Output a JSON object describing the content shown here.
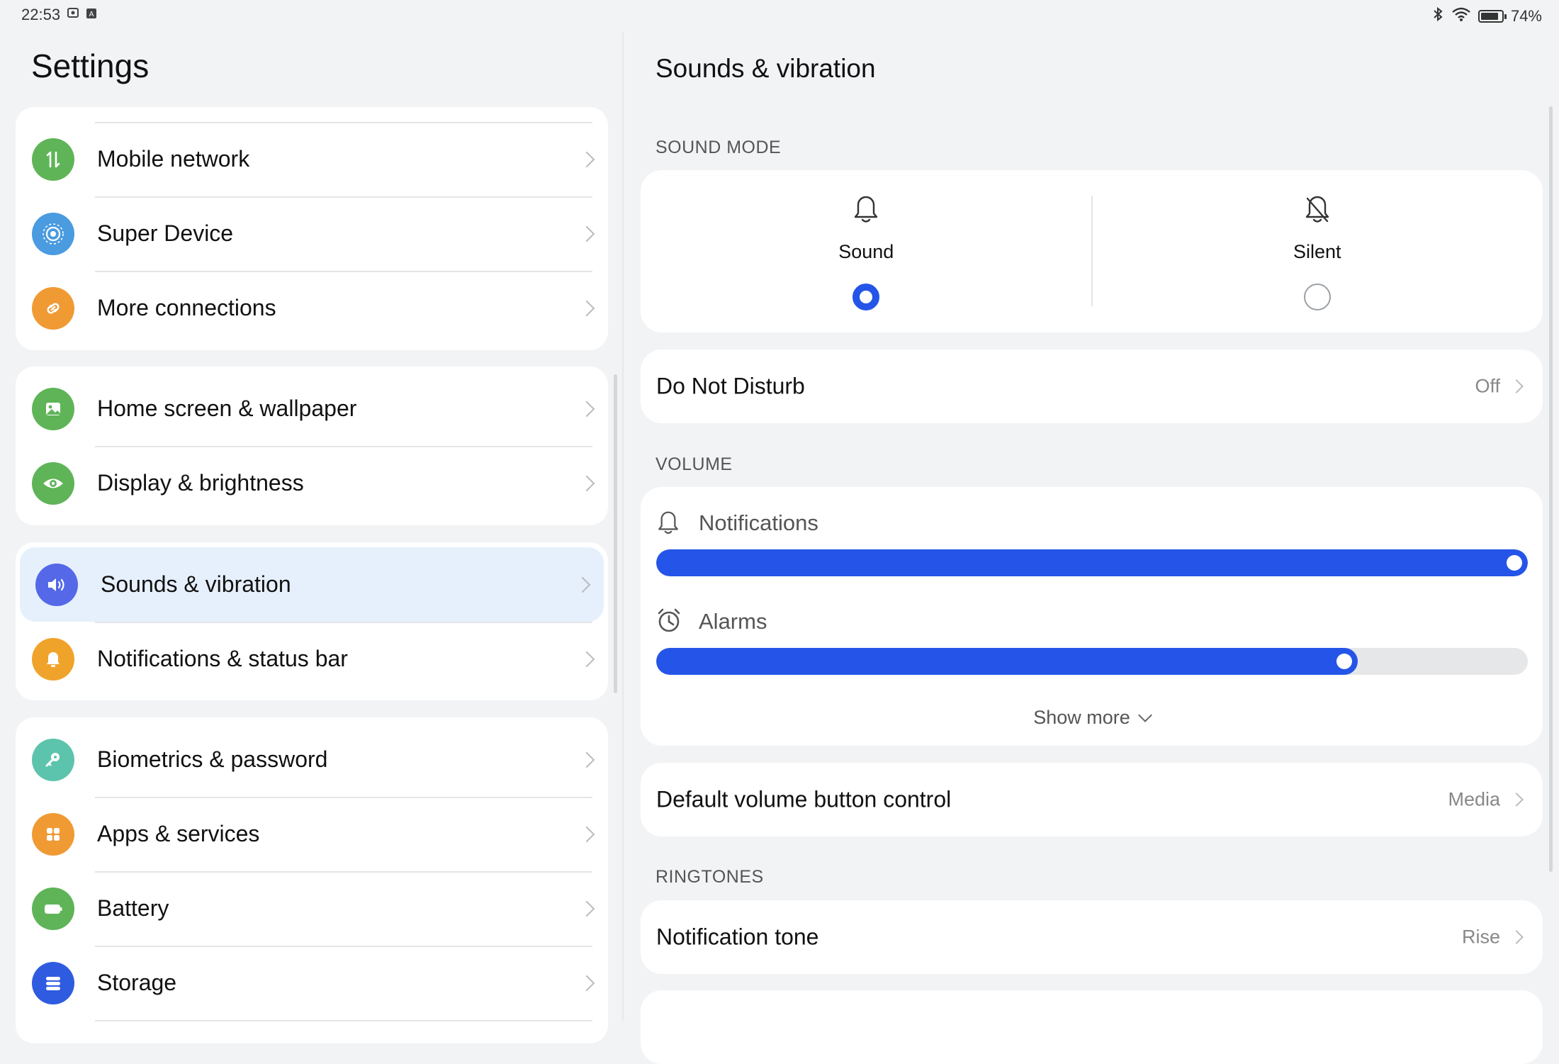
{
  "status_bar": {
    "time": "22:53",
    "battery_percent": "74%",
    "battery_level": 0.74
  },
  "left": {
    "title": "Settings",
    "groups": [
      {
        "items": [
          {
            "label": "Mobile network",
            "icon": "mobile-network-icon",
            "color": "#5fb457"
          },
          {
            "label": "Super Device",
            "icon": "super-device-icon",
            "color": "#4a9be0"
          },
          {
            "label": "More connections",
            "icon": "link-icon",
            "color": "#f09a34"
          }
        ]
      },
      {
        "items": [
          {
            "label": "Home screen & wallpaper",
            "icon": "wallpaper-icon",
            "color": "#5fb457"
          },
          {
            "label": "Display & brightness",
            "icon": "eye-icon",
            "color": "#5fb457"
          }
        ]
      },
      {
        "items": [
          {
            "label": "Sounds & vibration",
            "icon": "speaker-icon",
            "color": "#5468e8",
            "selected": true
          },
          {
            "label": "Notifications & status bar",
            "icon": "bell-icon",
            "color": "#f0a32a"
          }
        ]
      },
      {
        "items": [
          {
            "label": "Biometrics & password",
            "icon": "key-icon",
            "color": "#5cc4ac"
          },
          {
            "label": "Apps & services",
            "icon": "apps-icon",
            "color": "#f09a34"
          },
          {
            "label": "Battery",
            "icon": "battery-icon",
            "color": "#5fb457"
          },
          {
            "label": "Storage",
            "icon": "storage-icon",
            "color": "#2f5be0"
          }
        ]
      }
    ]
  },
  "right": {
    "title": "Sounds & vibration",
    "sound_mode": {
      "section_label": "SOUND MODE",
      "options": [
        {
          "label": "Sound",
          "selected": true
        },
        {
          "label": "Silent",
          "selected": false
        }
      ]
    },
    "do_not_disturb": {
      "label": "Do Not Disturb",
      "value": "Off"
    },
    "volume": {
      "section_label": "VOLUME",
      "sliders": [
        {
          "label": "Notifications",
          "icon": "bell-icon",
          "level": 1.0
        },
        {
          "label": "Alarms",
          "icon": "alarm-clock-icon",
          "level": 0.805
        }
      ],
      "show_more": "Show more"
    },
    "default_volume": {
      "label": "Default volume button control",
      "value": "Media"
    },
    "ringtones": {
      "section_label": "RINGTONES",
      "notification_tone": {
        "label": "Notification tone",
        "value": "Rise"
      }
    },
    "accent": "#2455e8"
  }
}
